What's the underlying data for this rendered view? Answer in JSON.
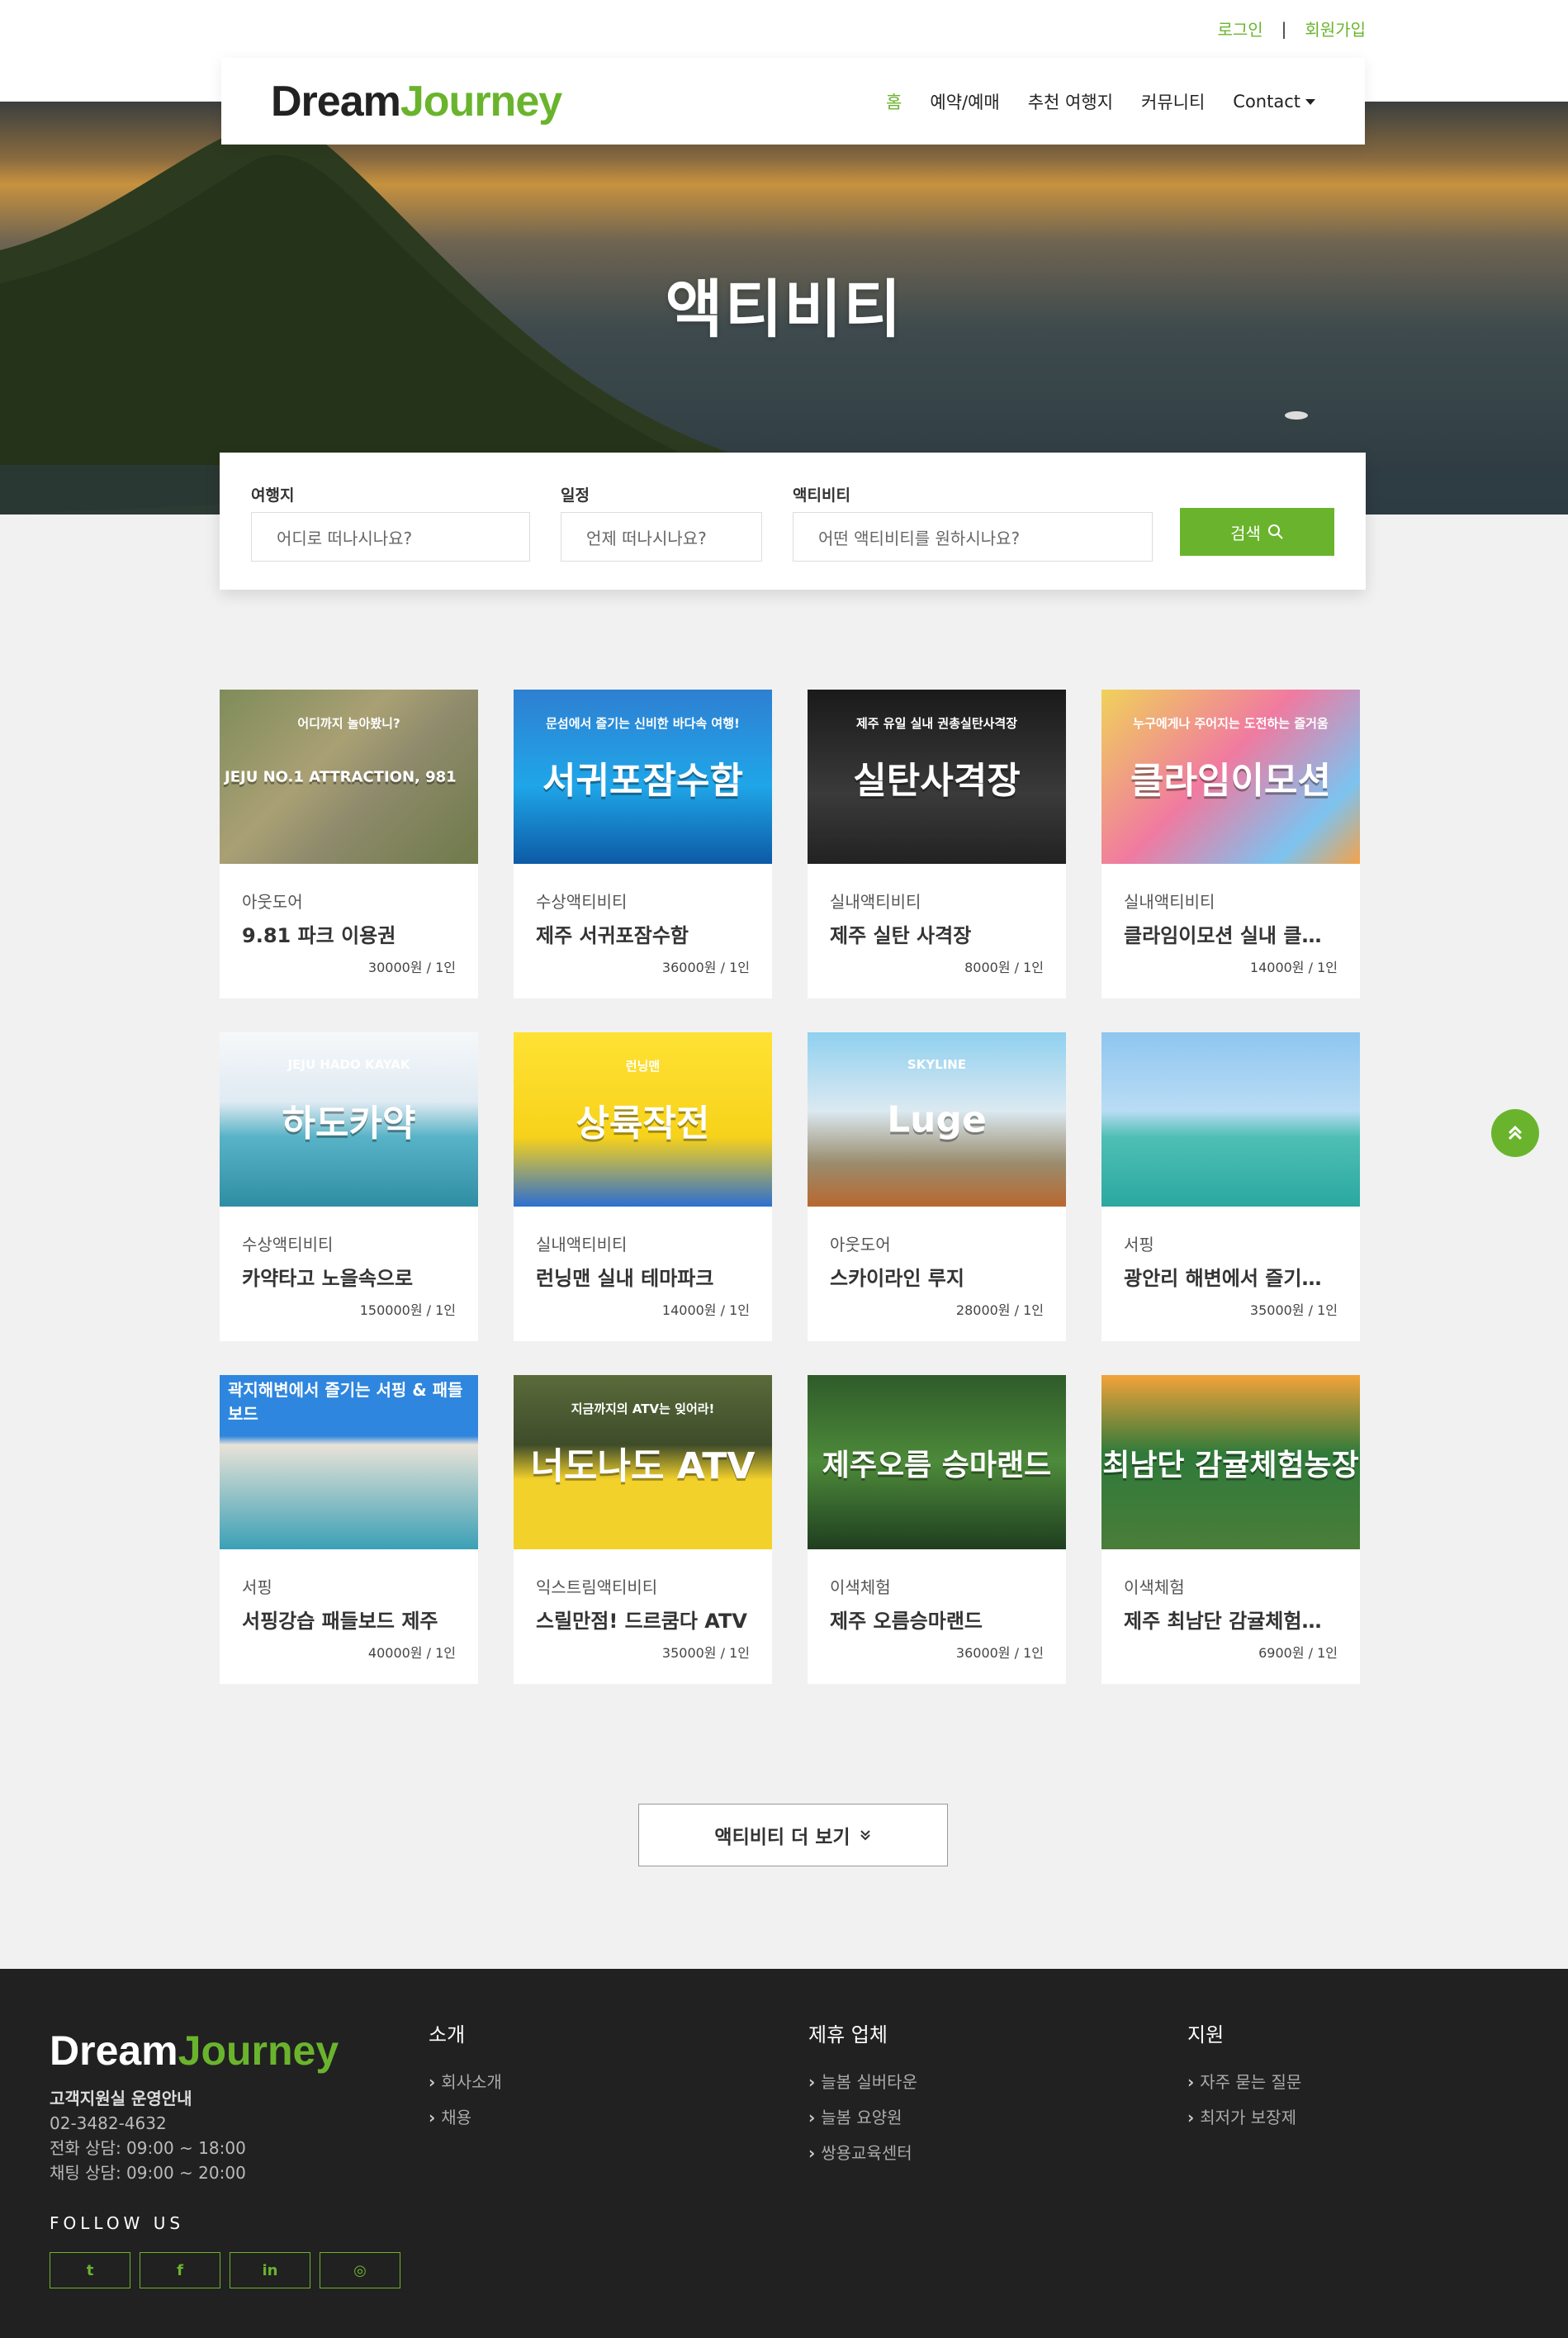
{
  "top_links": {
    "login": "로그인",
    "separator": "|",
    "signup": "회원가입"
  },
  "logo": {
    "part1": "Dream",
    "part2": "Journey"
  },
  "nav": {
    "home": "홈",
    "booking": "예약/예매",
    "recommend": "추천 여행지",
    "community": "커뮤니티",
    "contact": "Contact"
  },
  "hero": {
    "title": "액티비티"
  },
  "search": {
    "destination_label": "여행지",
    "destination_placeholder": "어디로 떠나시나요?",
    "date_label": "일정",
    "date_placeholder": "언제 떠나시나요?",
    "activity_label": "액티비티",
    "activity_placeholder": "어떤 액티비티를 원하시나요?",
    "button": "검색"
  },
  "activities": [
    {
      "category": "아웃도어",
      "title": "9.81 파크 이용권",
      "price": "30000원 / 1인",
      "thumb_text": "JEJU NO.1 ATTRACTION, 981",
      "thumb_sub": "어디까지 놀아봤니?"
    },
    {
      "category": "수상액티비티",
      "title": "제주 서귀포잠수함",
      "price": "36000원 / 1인",
      "thumb_text": "서귀포잠수함",
      "thumb_sub": "문섬에서 즐기는 신비한 바다속 여행!"
    },
    {
      "category": "실내액티비티",
      "title": "제주 실탄 사격장",
      "price": "8000원 / 1인",
      "thumb_text": "실탄사격장",
      "thumb_sub": "제주 유일 실내 권총실탄사격장"
    },
    {
      "category": "실내액티비티",
      "title": "클라임이모션 실내 클라이밍",
      "price": "14000원 / 1인",
      "thumb_text": "클라임이모션",
      "thumb_sub": "누구에게나 주어지는 도전하는 즐거움"
    },
    {
      "category": "수상액티비티",
      "title": "카약타고 노을속으로",
      "price": "150000원 / 1인",
      "thumb_text": "하도카약",
      "thumb_sub": "JEJU HADO KAYAK"
    },
    {
      "category": "실내액티비티",
      "title": "런닝맨 실내 테마파크",
      "price": "14000원 / 1인",
      "thumb_text": "상륙작전",
      "thumb_sub": "런닝맨"
    },
    {
      "category": "아웃도어",
      "title": "스카이라인 루지",
      "price": "28000원 / 1인",
      "thumb_text": "Luge",
      "thumb_sub": "SKYLINE"
    },
    {
      "category": "서핑",
      "title": "광안리 해변에서 즐기는 윈드서핑",
      "price": "35000원 / 1인",
      "thumb_text": "",
      "thumb_sub": ""
    },
    {
      "category": "서핑",
      "title": "서핑강습 패들보드 제주",
      "price": "40000원 / 1인",
      "thumb_text": "",
      "thumb_sub": "곽지해변에서 즐기는 서핑 & 패들보드"
    },
    {
      "category": "익스트림액티비티",
      "title": "스릴만점! 드르쿰다 ATV",
      "price": "35000원 / 1인",
      "thumb_text": "너도나도 ATV",
      "thumb_sub": "지금까지의 ATV는 잊어라!"
    },
    {
      "category": "이색체험",
      "title": "제주 오름승마랜드",
      "price": "36000원 / 1인",
      "thumb_text": "제주오름 승마랜드",
      "thumb_sub": ""
    },
    {
      "category": "이색체험",
      "title": "제주 최남단 감귤체험농장",
      "price": "6900원 / 1인",
      "thumb_text": "최남단 감귤체험농장",
      "thumb_sub": ""
    }
  ],
  "more_button": "액티비티 더 보기",
  "footer": {
    "support_title": "고객지원실 운영안내",
    "phone": "02-3482-4632",
    "phone_hours": "전화 상담: 09:00 ~ 18:00",
    "chat_hours": "채팅 상담: 09:00 ~ 20:00",
    "follow": "FOLLOW US",
    "col1_title": "소개",
    "col1_items": [
      "회사소개",
      "채용"
    ],
    "col2_title": "제휴 업체",
    "col2_items": [
      "늘봄 실버타운",
      "늘봄 요양원",
      "쌍용교육센터"
    ],
    "col3_title": "지원",
    "col3_items": [
      "자주 묻는 질문",
      "최저가 보장제"
    ]
  },
  "colors": {
    "accent": "#6ab42d",
    "footer_bg": "#212121",
    "page_bg": "#f1f1f1"
  }
}
